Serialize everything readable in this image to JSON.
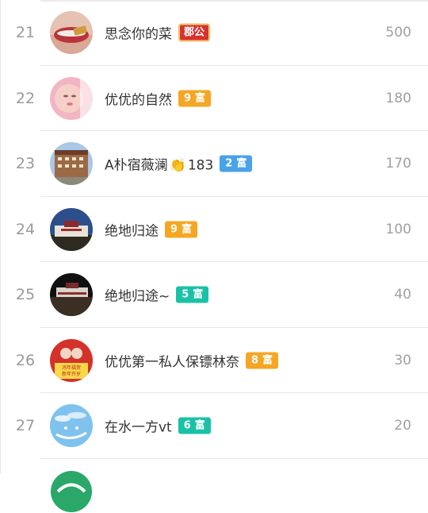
{
  "rows": [
    {
      "rank": "21",
      "name": "思念你的菜",
      "badge_num": "",
      "badge_label": "郡公",
      "badge_color": "#d8322e",
      "score": "500",
      "avatar": "lips-avatar"
    },
    {
      "rank": "22",
      "name": "优优的自然",
      "badge_num": "9",
      "badge_label": "富",
      "badge_color": "#f5a623",
      "score": "180",
      "avatar": "baby-avatar"
    },
    {
      "rank": "23",
      "name_before": "A",
      "name_box": "",
      "name_middle": "朴宿薇澜",
      "name_after": "183",
      "badge_num": "2",
      "badge_label": "富",
      "badge_color": "#4aa3ea",
      "score": "170",
      "avatar": "building-avatar"
    },
    {
      "rank": "24",
      "name": "绝地归途",
      "badge_num": "9",
      "badge_label": "富",
      "badge_color": "#f5a623",
      "score": "100",
      "avatar": "palace-avatar"
    },
    {
      "rank": "25",
      "name": "绝地归途~",
      "badge_num": "5",
      "badge_label": "富",
      "badge_color": "#19c2a6",
      "score": "40",
      "avatar": "palace-avatar-2"
    },
    {
      "rank": "26",
      "name": "优优第一私人保镖林奈",
      "badge_num": "8",
      "badge_label": "富",
      "badge_color": "#f5a623",
      "score": "30",
      "avatar": "newyear-avatar"
    },
    {
      "rank": "27",
      "name": "在水一方vt",
      "badge_num": "6",
      "badge_label": "富",
      "badge_color": "#19c2a6",
      "score": "20",
      "avatar": "sky-avatar"
    }
  ],
  "newyear_text": [
    "鸿年福贺",
    "新年开岁"
  ]
}
